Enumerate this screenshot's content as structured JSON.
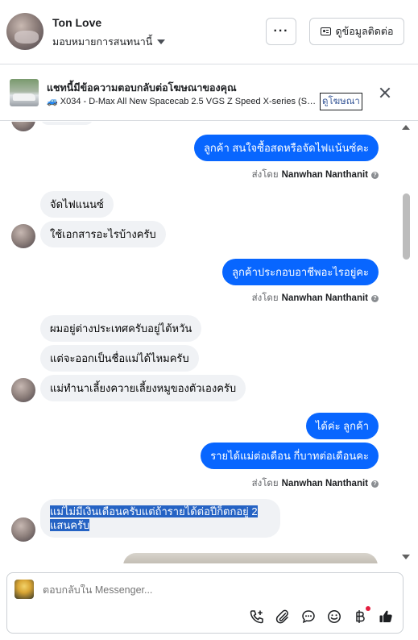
{
  "header": {
    "name": "Ton Love",
    "assign_label": "มอบหมายการสนทนานี้",
    "more_label": "···",
    "contact_button": "ดูข้อมูลติดต่อ"
  },
  "ad_banner": {
    "title": "แชทนี้มีข้อความตอบกลับต่อโฆษณาของคุณ",
    "subtitle": "🚙 X034 - D-Max All New Spacecab 2.5 VGS Z Speed X-series (Super...",
    "link": "ดูโฆษณา"
  },
  "messages": [
    {
      "side": "out",
      "text": "ลูกค้า สนใจซื้อสดหรือจัดไฟแน้นซ์คะ"
    },
    {
      "side": "out",
      "text": "ลูกค้าประกอบอาชีพอะไรอยู่คะ"
    },
    {
      "side": "in",
      "text": "จัดไฟแนนซ์"
    },
    {
      "side": "in",
      "text": "ใช้เอกสารอะไรบ้างครับ"
    },
    {
      "side": "in",
      "text": "ผมอยู่ต่างประเทศครับอยู่ไต้หวัน"
    },
    {
      "side": "in",
      "text": "แต่จะออกเป็นชื่อแม่ได้ไหมครับ"
    },
    {
      "side": "in",
      "text": "แม่ทำนาเลี้ยงควายเลี้ยงหมูของตัวเองครับ"
    },
    {
      "side": "out",
      "text": "ได้ค่ะ  ลูกค้า"
    },
    {
      "side": "out",
      "text": "รายได้แม่ต่อเดือน กี่บาทต่อเดือนคะ"
    },
    {
      "side": "in",
      "text_line1": "แม่ไม่มีเงินเดือนครับแต่ถ้ารายได้ต่อปีก็ตกอยู่ 2",
      "text_line2": "แสนครับ"
    }
  ],
  "sent_by": {
    "prefix": "ส่งโดย",
    "name": "Nanwhan Nanthanit",
    "info": "?"
  },
  "composer": {
    "placeholder": "ตอบกลับใน Messenger...",
    "tools": [
      "call-add-icon",
      "attachment-icon",
      "chat-bubble-icon",
      "emoji-icon",
      "baht-icon",
      "like-icon"
    ]
  },
  "colors": {
    "outgoing": "#0866ff",
    "incoming": "#f0f2f5",
    "highlight": "#2563c4"
  }
}
